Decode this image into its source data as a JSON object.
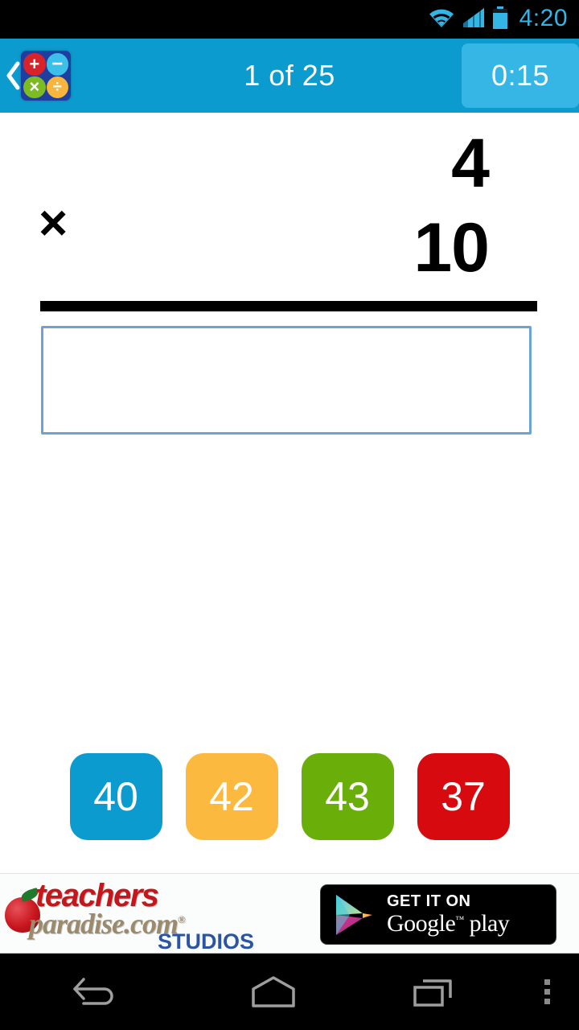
{
  "status_bar": {
    "time": "4:20",
    "icons": [
      "wifi-icon",
      "cellular-signal-icon",
      "battery-icon"
    ],
    "icon_color": "#33b5e5"
  },
  "header": {
    "back_icon": "chevron-left-icon",
    "app_icon": {
      "name": "math-app-icon",
      "operations": [
        "+",
        "−",
        "×",
        "÷"
      ],
      "colors": [
        "#d8232a",
        "#3cbfe8",
        "#7dbb22",
        "#f7b53c"
      ],
      "background": "#1f3fa0"
    },
    "progress_label": "1 of 25",
    "timer_label": "0:15",
    "background": "#0c9bce",
    "timer_background": "#35b6e5"
  },
  "problem": {
    "operand_top": "4",
    "operator": "×",
    "operand_bottom": "10",
    "answer_value": "",
    "answer_placeholder": "",
    "rule_color": "#000000",
    "answer_border_color": "#6da2d6"
  },
  "choices": [
    {
      "label": "40",
      "color": "#0c9bce"
    },
    {
      "label": "42",
      "color": "#fcb93f"
    },
    {
      "label": "43",
      "color": "#6aae0a"
    },
    {
      "label": "37",
      "color": "#d60a0f"
    }
  ],
  "ad": {
    "brand_line1": "teachers",
    "brand_line2": "paradise.com",
    "brand_registered": "®",
    "brand_line3": "STUDIOS",
    "apple_icon": "apple-icon",
    "store_badge": {
      "icon": "google-play-triangle-icon",
      "get_it_on": "GET IT ON",
      "store_name_part1": "Google",
      "store_trademark": "™",
      "store_name_part2": "play"
    }
  },
  "navbar": {
    "back": "back-nav-icon",
    "home": "home-nav-icon",
    "recents": "recents-nav-icon",
    "menu": "overflow-menu-icon"
  }
}
